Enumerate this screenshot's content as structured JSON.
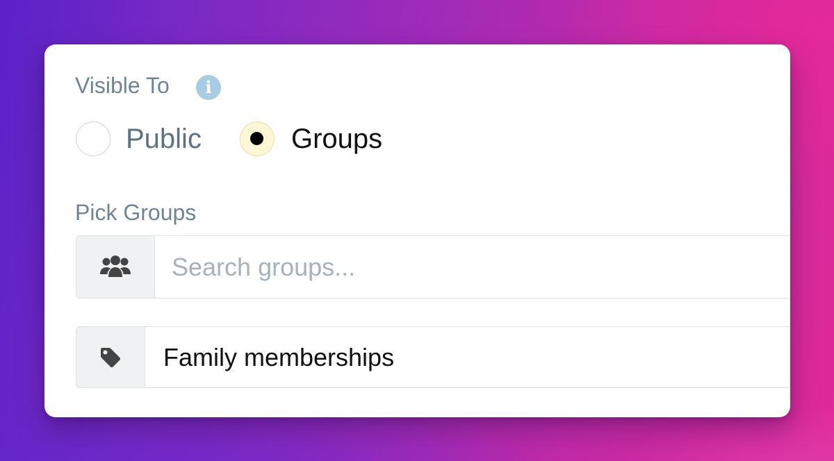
{
  "visibility": {
    "label": "Visible To",
    "info_icon": "info-circle-icon",
    "options": [
      {
        "label": "Public",
        "checked": false
      },
      {
        "label": "Groups",
        "checked": true
      }
    ]
  },
  "groups": {
    "label": "Pick Groups",
    "search_icon": "users-group-icon",
    "search_placeholder": "Search groups...",
    "search_value": "",
    "selected_icon": "tag-icon",
    "selected_group": "Family memberships"
  },
  "colors": {
    "label_text": "#6f8596",
    "info_icon_bg": "#a6cde3",
    "checked_radio_bg": "#fcf8d6",
    "addon_bg": "#eff1f3"
  }
}
